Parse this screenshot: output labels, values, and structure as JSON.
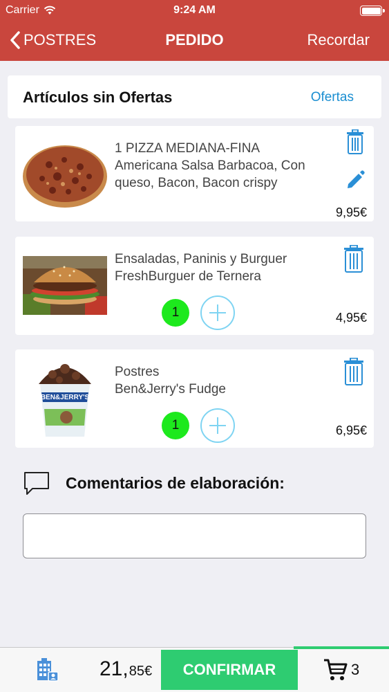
{
  "status": {
    "carrier": "Carrier",
    "time": "9:24 AM"
  },
  "nav": {
    "back_label": "POSTRES",
    "title": "PEDIDO",
    "right_label": "Recordar"
  },
  "section": {
    "title": "Artículos sin Ofertas",
    "link": "Ofertas"
  },
  "items": [
    {
      "line1": "1 PIZZA MEDIANA-FINA",
      "line2": "Americana Salsa Barbacoa, Con",
      "line3": "queso, Bacon, Bacon crispy",
      "price": "9,95€",
      "thumb": "pizza-image"
    },
    {
      "line1": "Ensaladas, Paninis y Burguer",
      "line2": "FreshBurguer de Ternera",
      "qty": "1",
      "price": "4,95€",
      "thumb": "burger-image"
    },
    {
      "line1": "Postres",
      "line2": "Ben&Jerry's Fudge",
      "qty": "1",
      "price": "6,95€",
      "thumb": "ice-cream-tub-image",
      "tub_label": "BEN&JERRY'S"
    }
  ],
  "comments": {
    "label": "Comentarios de elaboración:",
    "value": "",
    "placeholder": ""
  },
  "footer": {
    "total_int": "21,",
    "total_dec": "85€",
    "confirm_label": "CONFIRMAR",
    "cart_count": "3"
  },
  "colors": {
    "brand_red": "#c9463d",
    "accent_blue": "#1a8ed1",
    "confirm_green": "#2ecc71",
    "qty_green": "#1de91d"
  }
}
